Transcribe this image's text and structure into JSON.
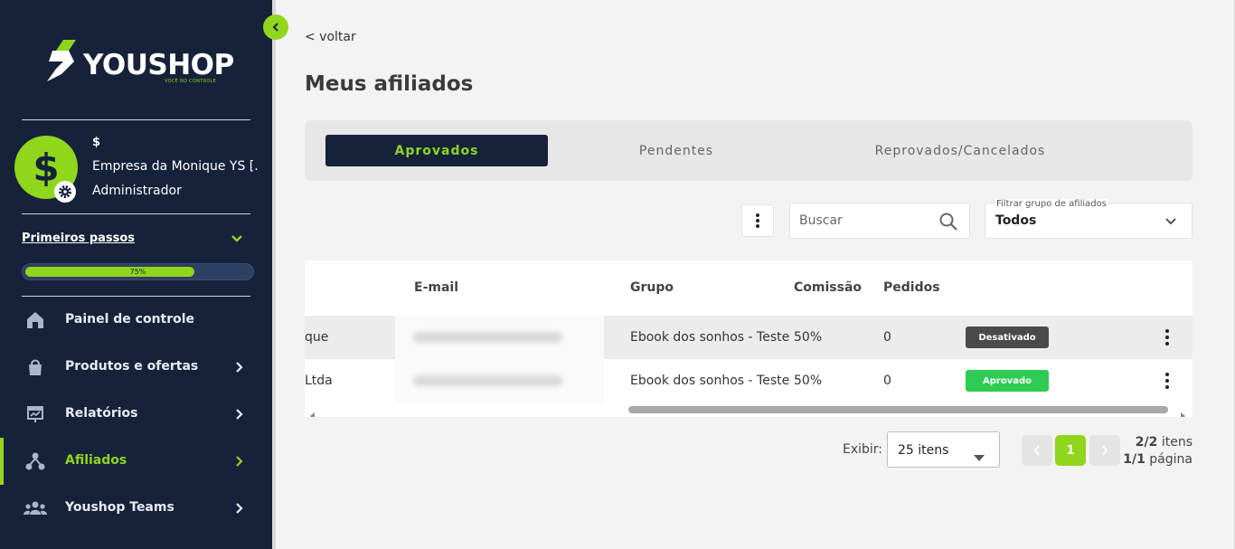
{
  "sidebar": {
    "logo_text": "YOUSHOP",
    "logo_tagline": "VOCÊ NO CONTROLE",
    "user": {
      "symbol": "$",
      "company": "Empresa da Monique YS [...",
      "role": "Administrador"
    },
    "first_steps": {
      "label": "Primeiros passos",
      "progress_percent": 75,
      "progress_label": "75%"
    },
    "nav": [
      {
        "label": "Painel de controle",
        "icon": "house-icon",
        "has_submenu": false,
        "active": false
      },
      {
        "label": "Produtos e ofertas",
        "icon": "bag-icon",
        "has_submenu": true,
        "active": false
      },
      {
        "label": "Relatórios",
        "icon": "report-icon",
        "has_submenu": true,
        "active": false
      },
      {
        "label": "Afiliados",
        "icon": "affiliates-icon",
        "has_submenu": true,
        "active": true
      },
      {
        "label": "Youshop Teams",
        "icon": "team-icon",
        "has_submenu": true,
        "active": false
      }
    ]
  },
  "main": {
    "back_label": "< voltar",
    "title": "Meus afiliados",
    "tabs": [
      {
        "label": "Aprovados",
        "active": true
      },
      {
        "label": "Pendentes",
        "active": false
      },
      {
        "label": "Reprovados/Cancelados",
        "active": false
      }
    ],
    "search": {
      "placeholder": "Buscar"
    },
    "filter": {
      "label": "Filtrar grupo de afiliados",
      "value": "Todos"
    },
    "table": {
      "columns": [
        "E-mail",
        "Grupo",
        "Comissão",
        "Pedidos"
      ],
      "rows": [
        {
          "name": "que",
          "email": "",
          "group": "Ebook dos sonhos - Teste",
          "commission": "50%",
          "orders": "0",
          "status": "Desativado",
          "status_color": "#4a4a4a"
        },
        {
          "name": "Ltda",
          "email": "",
          "group": "Ebook dos sonhos - Teste",
          "commission": "50%",
          "orders": "0",
          "status": "Aprovado",
          "status_color": "#2ecc52"
        }
      ]
    },
    "pagination": {
      "show_label": "Exibir:",
      "page_size": "25 itens",
      "current_page": "1",
      "items_count": "2/2",
      "items_label": "itens",
      "page_count": "1/1",
      "page_label": "página"
    }
  },
  "colors": {
    "sidebar_bg": "#16213a",
    "accent": "#8fd61c",
    "active_tab_bg": "#16213a"
  }
}
